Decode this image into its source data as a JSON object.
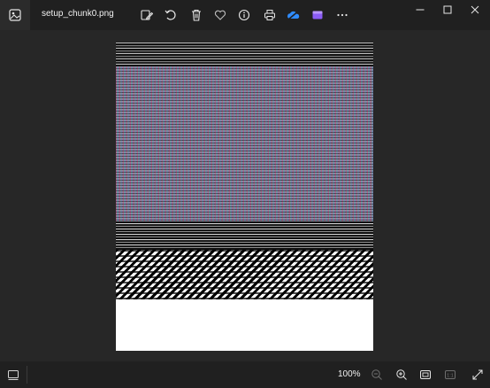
{
  "window": {
    "file_name": "setup_chunk0.png"
  },
  "toolbar": {
    "icons": [
      "edit-image-icon",
      "rotate-icon",
      "delete-icon",
      "favorite-icon",
      "info-icon",
      "print-icon",
      "onedrive-icon",
      "clipchamp-icon",
      "more-options-icon"
    ]
  },
  "window_controls": [
    "minimize-icon",
    "maximize-icon",
    "close-icon"
  ],
  "statusbar": {
    "zoom_level": "100%",
    "actual_size_label": "1:1"
  },
  "colors": {
    "background": "#202020",
    "canvas": "#272727",
    "onedrive_blue": "#2f8cff",
    "clipchamp_purple": "#8b5cf6"
  }
}
